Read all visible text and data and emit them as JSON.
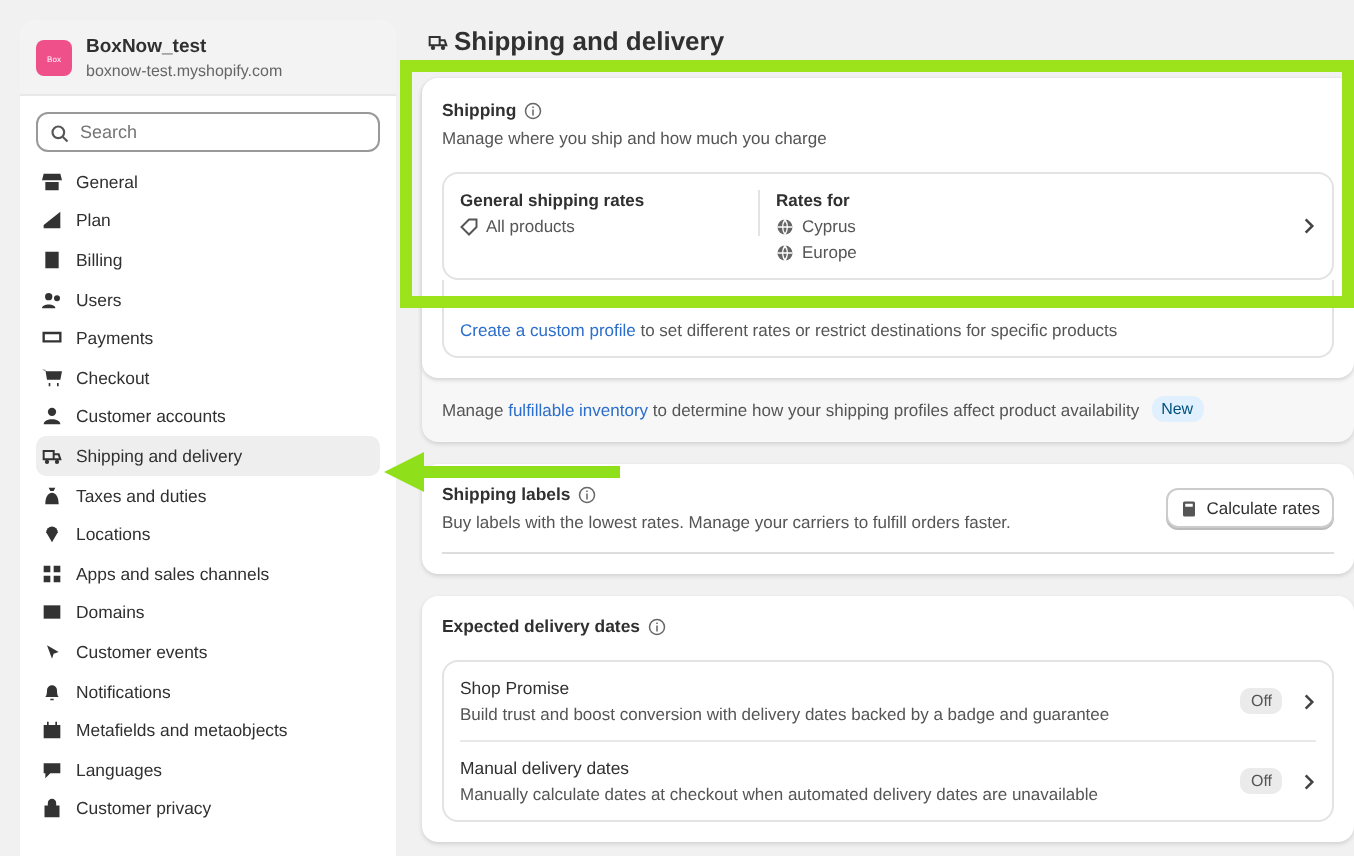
{
  "store": {
    "logo": "Box",
    "name": "BoxNow_test",
    "domain": "boxnow-test.myshopify.com"
  },
  "search": {
    "placeholder": "Search"
  },
  "sidebar": {
    "items": [
      {
        "label": "General",
        "selected": false
      },
      {
        "label": "Plan",
        "selected": false
      },
      {
        "label": "Billing",
        "selected": false
      },
      {
        "label": "Users",
        "selected": false
      },
      {
        "label": "Payments",
        "selected": false
      },
      {
        "label": "Checkout",
        "selected": false
      },
      {
        "label": "Customer accounts",
        "selected": false
      },
      {
        "label": "Shipping and delivery",
        "selected": true
      },
      {
        "label": "Taxes and duties",
        "selected": false
      },
      {
        "label": "Locations",
        "selected": false
      },
      {
        "label": "Apps and sales channels",
        "selected": false
      },
      {
        "label": "Domains",
        "selected": false
      },
      {
        "label": "Customer events",
        "selected": false
      },
      {
        "label": "Notifications",
        "selected": false
      },
      {
        "label": "Metafields and metaobjects",
        "selected": false
      },
      {
        "label": "Languages",
        "selected": false
      },
      {
        "label": "Customer privacy",
        "selected": false
      }
    ]
  },
  "page_title": "Shipping and delivery",
  "shipping": {
    "title": "Shipping",
    "description": "Manage where you ship and how much you charge",
    "general_rates": {
      "title": "General shipping rates",
      "products": "All products",
      "rates_for_label": "Rates for",
      "regions": [
        "Cyprus",
        "Europe"
      ]
    },
    "custom_profile": {
      "link": "Create a custom profile",
      "text": "to set different rates or restrict destinations for specific products"
    },
    "inventory": {
      "before": "Manage",
      "link": "fulfillable inventory",
      "after": "to determine how your shipping profiles affect product availability",
      "badge": "New"
    }
  },
  "shipping_labels": {
    "title": "Shipping labels",
    "description": "Buy labels with the lowest rates. Manage your carriers to fulfill orders faster.",
    "button": "Calculate rates"
  },
  "delivery_dates": {
    "title": "Expected delivery dates",
    "rows": [
      {
        "title": "Shop Promise",
        "description": "Build trust and boost conversion with delivery dates backed by a badge and guarantee",
        "status": "Off",
        "on": false
      },
      {
        "title": "Manual delivery dates",
        "description": "Manually calculate dates at checkout when automated delivery dates are unavailable",
        "status": "Off",
        "on": false
      }
    ]
  }
}
